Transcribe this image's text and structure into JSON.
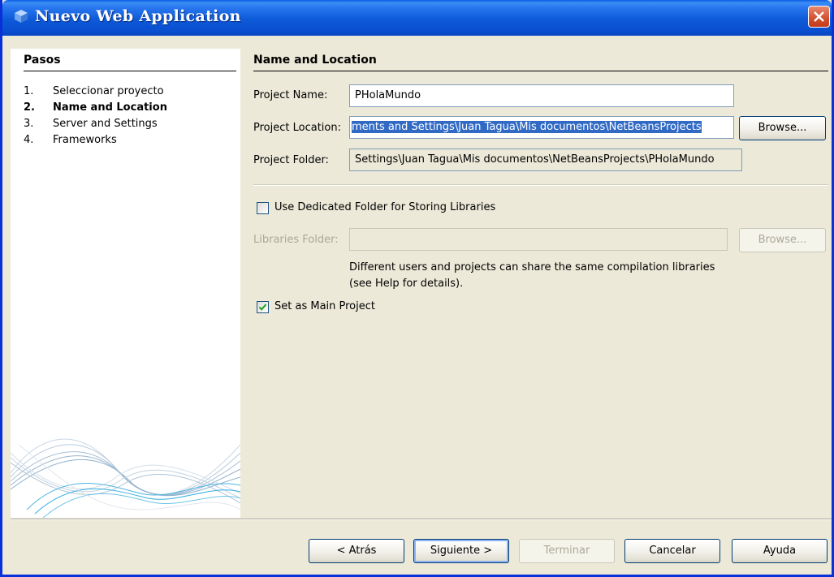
{
  "window": {
    "title": "Nuevo  Web Application"
  },
  "steps_panel": {
    "heading": "Pasos",
    "items": [
      {
        "num": "1.",
        "label": "Seleccionar proyecto"
      },
      {
        "num": "2.",
        "label": "Name and Location"
      },
      {
        "num": "3.",
        "label": "Server and Settings"
      },
      {
        "num": "4.",
        "label": "Frameworks"
      }
    ],
    "current_index": 1
  },
  "form": {
    "section_title": "Name and Location",
    "project_name": {
      "label": "Project Name:",
      "value": "PHolaMundo"
    },
    "project_location": {
      "label": "Project Location:",
      "value": "ments and Settings\\Juan Tagua\\Mis documentos\\NetBeansProjects",
      "browse": "Browse..."
    },
    "project_folder": {
      "label": "Project Folder:",
      "value": "Settings\\Juan Tagua\\Mis documentos\\NetBeansProjects\\PHolaMundo"
    },
    "dedicated_folder": {
      "label": "Use Dedicated Folder for Storing Libraries",
      "checked": false
    },
    "libraries_folder": {
      "label": "Libraries Folder:",
      "value": "",
      "browse": "Browse..."
    },
    "hint_line1": "Different users and projects can share the same compilation libraries",
    "hint_line2": "(see Help for details).",
    "main_project": {
      "label": "Set as Main Project",
      "checked": true
    }
  },
  "buttons": {
    "back": "< Atrás",
    "next": "Siguiente >",
    "finish": "Terminar",
    "cancel": "Cancelar",
    "help": "Ayuda"
  },
  "colors": {
    "titlebar": "#0a4fcf",
    "selection": "#316ac5",
    "dialog_bg": "#ece9d8"
  }
}
